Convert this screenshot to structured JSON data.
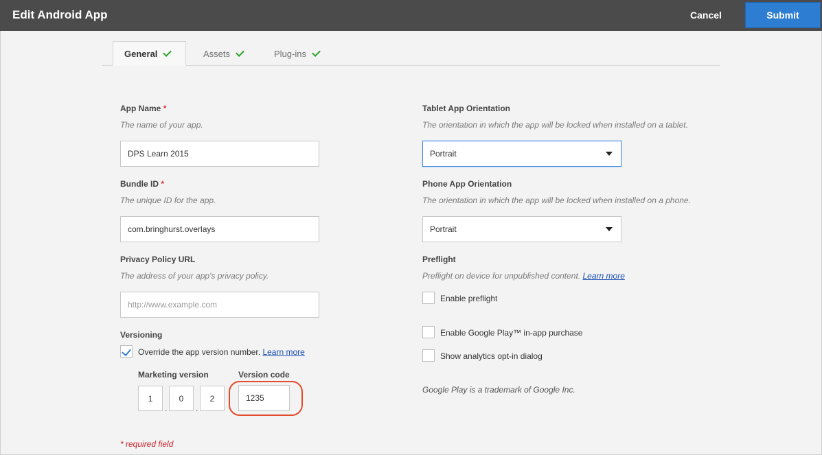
{
  "header": {
    "title": "Edit Android App",
    "cancel_label": "Cancel",
    "submit_label": "Submit"
  },
  "tabs": [
    {
      "label": "General",
      "complete": true,
      "active": true
    },
    {
      "label": "Assets",
      "complete": true,
      "active": false
    },
    {
      "label": "Plug-ins",
      "complete": true,
      "active": false
    }
  ],
  "left": {
    "app_name": {
      "label": "App Name",
      "required_mark": "*",
      "description": "The name of your app.",
      "value": "DPS Learn 2015"
    },
    "bundle_id": {
      "label": "Bundle ID",
      "required_mark": "*",
      "description": "The unique ID for the app.",
      "value": "com.bringhurst.overlays"
    },
    "privacy": {
      "label": "Privacy Policy URL",
      "description": "The address of your app's privacy policy.",
      "value": "",
      "placeholder": "http://www.example.com"
    },
    "versioning": {
      "label": "Versioning",
      "override_label": "Override the app version number.",
      "override_checked": true,
      "learn_more": "Learn more",
      "marketing_label": "Marketing version",
      "version_code_label": "Version code",
      "marketing_parts": [
        "1",
        "0",
        "2"
      ],
      "version_code": "1235",
      "separator": "."
    },
    "required_note": "* required field"
  },
  "right": {
    "tablet": {
      "label": "Tablet App Orientation",
      "description": "The orientation in which the app will be locked when installed on a tablet.",
      "value": "Portrait"
    },
    "phone": {
      "label": "Phone App Orientation",
      "description": "The orientation in which the app will be locked when installed on a phone.",
      "value": "Portrait"
    },
    "preflight": {
      "label": "Preflight",
      "description": "Preflight on device for unpublished content.",
      "learn_more": "Learn more",
      "enable_label": "Enable preflight",
      "enable_checked": false
    },
    "google_play_purchase": {
      "label": "Enable Google Play™ in-app purchase",
      "checked": false
    },
    "analytics": {
      "label": "Show analytics opt-in dialog",
      "checked": false
    },
    "trademark": "Google Play is a trademark of Google Inc."
  },
  "colors": {
    "header_bg": "#4b4b4b",
    "accent": "#2d7dd2",
    "check_green": "#2aa52a",
    "required_red": "#d7373f",
    "highlight_ring": "#e24a2a"
  }
}
